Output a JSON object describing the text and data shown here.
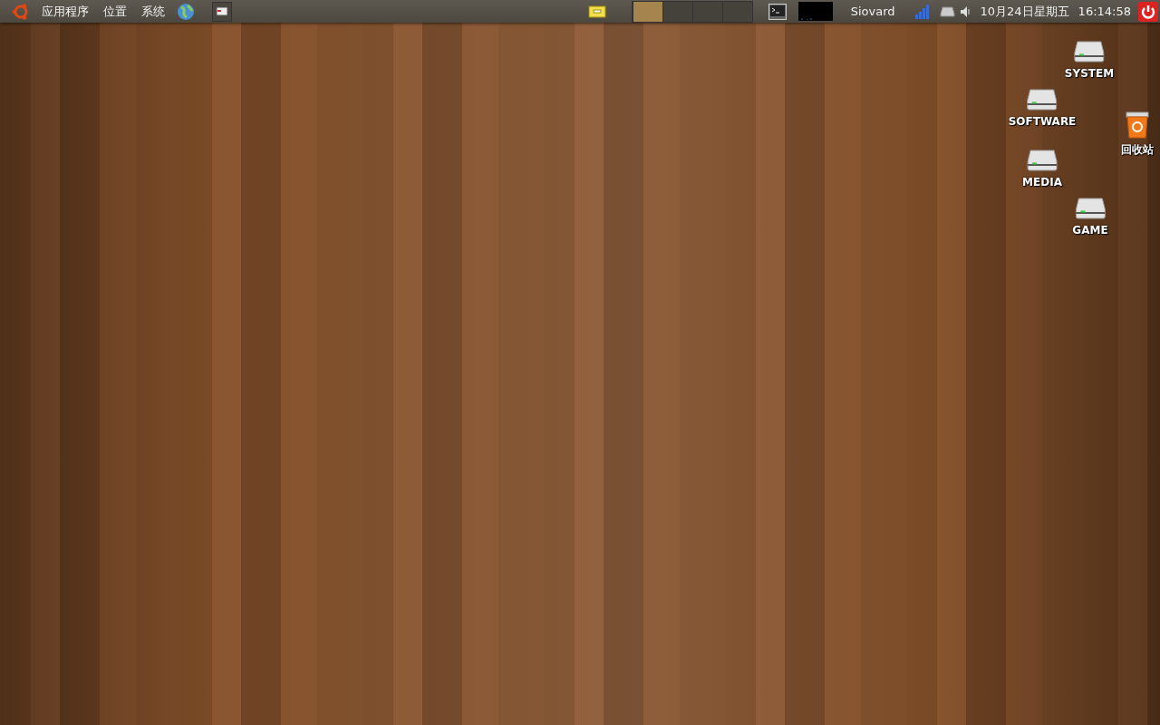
{
  "panel": {
    "menus": [
      {
        "label": "应用程序"
      },
      {
        "label": "位置"
      },
      {
        "label": "系统"
      }
    ],
    "workspaces": [
      {
        "selected": true
      },
      {
        "selected": false
      },
      {
        "selected": false
      },
      {
        "selected": false
      }
    ],
    "user": "Siovard",
    "clock": {
      "date": "10月24日星期五",
      "time": "16:14:58"
    }
  },
  "desktop_icons": [
    {
      "label": "SYSTEM",
      "kind": "drive"
    },
    {
      "label": "SOFTWARE",
      "kind": "drive"
    },
    {
      "label": "回收站",
      "kind": "trash"
    },
    {
      "label": "MEDIA",
      "kind": "drive"
    },
    {
      "label": "GAME",
      "kind": "drive"
    }
  ]
}
